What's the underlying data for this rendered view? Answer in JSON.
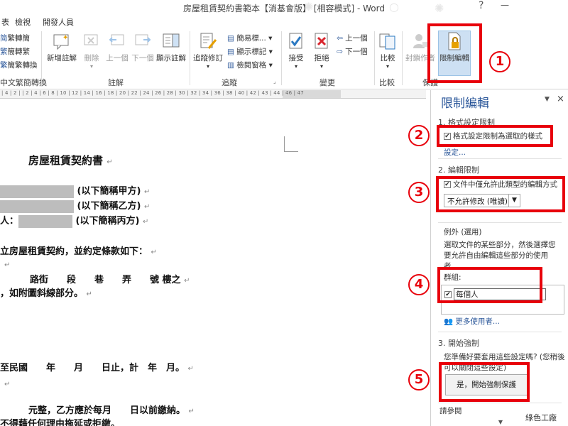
{
  "window": {
    "title": "房屋租賃契約書範本【消基會版】 [相容模式] - Word",
    "help": "?",
    "minimize": "—"
  },
  "ribbon_tabs": [
    "表",
    "檢視",
    "開發人員"
  ],
  "ribbon": {
    "chinese_convert": {
      "items": [
        "繁轉簡",
        "簡轉繁",
        "簡繁轉換"
      ],
      "group_label": "中文繁簡轉換"
    },
    "comments": {
      "new_comment": "新增註解",
      "delete": "刪除",
      "previous": "上一個",
      "next": "下一個",
      "show_comments": "顯示註解",
      "group_label": "註解"
    },
    "tracking": {
      "track_changes": "追蹤修訂",
      "simple_markup": "簡易標...",
      "show_markup": "顯示標記",
      "reviewing_pane": "檢閱窗格",
      "group_label": "追蹤"
    },
    "changes": {
      "accept": "接受",
      "reject": "拒絕",
      "previous": "上一個",
      "next": "下一個",
      "group_label": "變更"
    },
    "compare": {
      "compare": "比較",
      "group_label": "比較"
    },
    "protect": {
      "block_authors": "封鎖作者",
      "restrict_editing": "限制編輯",
      "group_label": "保護"
    }
  },
  "ruler": {
    "ticks": "| 4 | 2 | | 2 | 4 | 6 | 8 | 10 | 12 | 14 | 16 | 18 | 20 | 22 | 24 | 26 | 28 | 30 | 32 | 34 | 36 | 38 | 40 | 42 | 43 | 44 | 46 | 47"
  },
  "document": {
    "heading": "房屋租賃契約書",
    "lines": [
      "(以下簡稱甲方)",
      "(以下簡稱乙方)",
      "人：",
      "(以下簡稱丙方)",
      "立房屋租賃契約，並約定條款如下：",
      "路街　　段　　巷　　弄　　號 樓之",
      "，如附圖斜線部分。",
      "至民國　　年　　月　　日止，計　年　月。",
      "元整，乙方應於每月　　日以前繳納。",
      "不得藉任何理由拖延或拒繳。"
    ],
    "para_mark": "↵"
  },
  "pane": {
    "title": "限制編輯",
    "close": "×",
    "pin": "▼",
    "section1": {
      "title": "1. 格式設定限制",
      "checkbox_label": "格式設定限制為選取的樣式",
      "settings_link": "設定..."
    },
    "section2": {
      "title": "2. 編輯限制",
      "checkbox_label": "文件中僅允許此類型的編輯方式",
      "select_value": "不允許修改 (唯讀)"
    },
    "exceptions": {
      "title": "例外 (選用)",
      "description_1": "選取文件的某些部分，然後選擇您",
      "description_2": "要允許自由編輯這些部分的使用",
      "description_3": "者。",
      "groups_label": "群組:",
      "group_item": "每個人",
      "more_users": "更多使用者..."
    },
    "section3": {
      "title": "3. 開始強制",
      "question_1": "您準備好要套用這些設定嗎? (您稍後",
      "question_2": "可以關閉這些設定)",
      "start_button": "是，開始強制保護"
    },
    "see_also": "請參閱"
  },
  "annotations": [
    "1",
    "2",
    "3",
    "4",
    "5"
  ],
  "watermark": "綠色工廠",
  "colors": {
    "annotation_red": "#e8000b",
    "accent_blue": "#2b579a"
  }
}
